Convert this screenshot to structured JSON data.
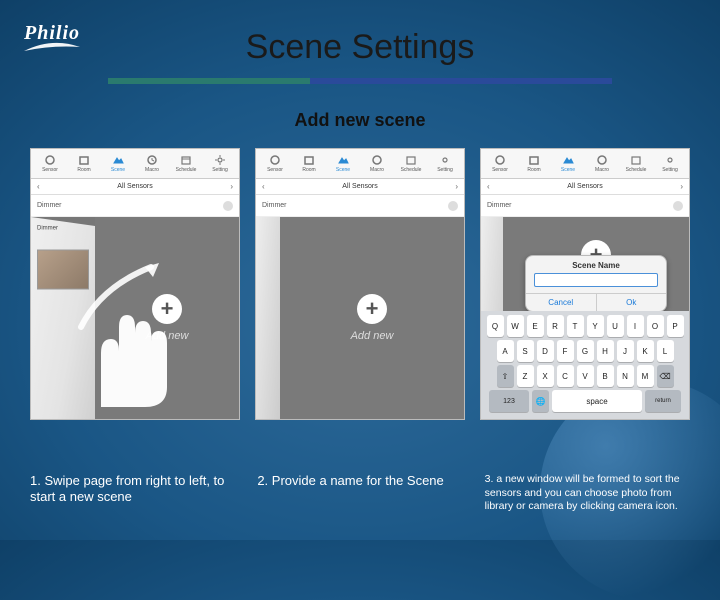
{
  "brand": {
    "name": "Philio"
  },
  "title": "Scene Settings",
  "subtitle": "Add new scene",
  "appbar": {
    "items": [
      {
        "label": "Sensor"
      },
      {
        "label": "Room"
      },
      {
        "label": "Scene"
      },
      {
        "label": "Macro"
      },
      {
        "label": "Schedule"
      },
      {
        "label": "Setting"
      }
    ]
  },
  "subbar": {
    "label": "All Sensors"
  },
  "listrow": {
    "label": "Dimmer",
    "count": "0"
  },
  "add": {
    "icon": "+",
    "label": "Add new"
  },
  "dialog": {
    "title": "Scene Name",
    "cancel": "Cancel",
    "ok": "Ok"
  },
  "keyboard": {
    "r1": [
      "Q",
      "W",
      "E",
      "R",
      "T",
      "Y",
      "U",
      "I",
      "O",
      "P"
    ],
    "r2": [
      "A",
      "S",
      "D",
      "F",
      "G",
      "H",
      "J",
      "K",
      "L"
    ],
    "shift": "⇧",
    "r3": [
      "Z",
      "X",
      "C",
      "V",
      "B",
      "N",
      "M"
    ],
    "back": "⌫",
    "numkey": "123",
    "globe": "🌐",
    "space": "space",
    "return": "return"
  },
  "captions": {
    "c1": "1. Swipe page from right to left, to start a new scene",
    "c2": "2. Provide a name for the Scene",
    "c3": "3. a new window will be formed to sort the sensors and you can choose photo from library or camera by clicking camera icon."
  }
}
